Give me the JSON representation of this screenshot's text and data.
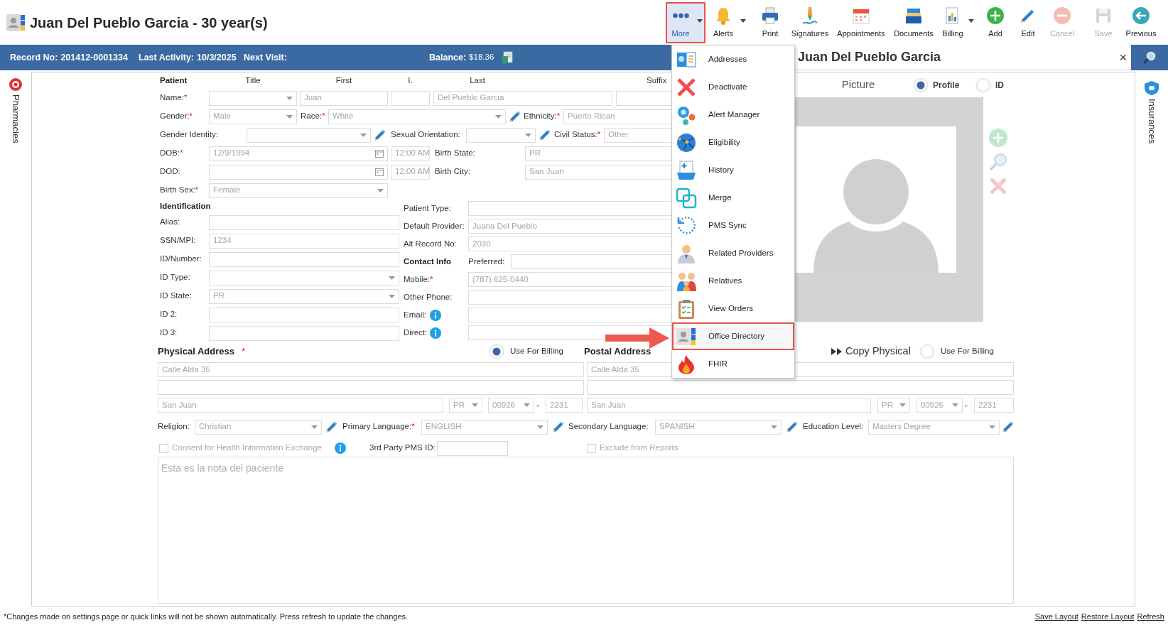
{
  "header": {
    "title": "Juan Del Pueblo Garcia - 30 year(s)",
    "toolbar": [
      {
        "label": "More",
        "highlighted": true,
        "dropdown": true,
        "disabled": false
      },
      {
        "label": "Alerts",
        "highlighted": false,
        "dropdown": true,
        "disabled": false
      },
      {
        "label": "Print",
        "highlighted": false,
        "dropdown": false,
        "disabled": false
      },
      {
        "label": "Signatures",
        "highlighted": false,
        "dropdown": false,
        "disabled": false
      },
      {
        "label": "Appointments",
        "highlighted": false,
        "dropdown": false,
        "disabled": false
      },
      {
        "label": "Documents",
        "highlighted": false,
        "dropdown": false,
        "disabled": false
      },
      {
        "label": "Billing",
        "highlighted": false,
        "dropdown": true,
        "disabled": false
      },
      {
        "label": "Add",
        "highlighted": false,
        "dropdown": false,
        "disabled": false
      },
      {
        "label": "Edit",
        "highlighted": false,
        "dropdown": false,
        "disabled": false
      },
      {
        "label": "Cancel",
        "highlighted": false,
        "dropdown": false,
        "disabled": true
      },
      {
        "label": "Save",
        "highlighted": false,
        "dropdown": false,
        "disabled": true
      },
      {
        "label": "Previous",
        "highlighted": false,
        "dropdown": false,
        "disabled": false
      }
    ]
  },
  "record_bar": {
    "items": [
      {
        "label": "Record No:",
        "value": "201412-0001334"
      },
      {
        "label": "Last Activity:",
        "value": "10/3/2025"
      },
      {
        "label": "Next Visit:"
      }
    ],
    "balance": {
      "label": "Balance:",
      "value": "$18.36"
    }
  },
  "more_menu": [
    {
      "label": "Addresses",
      "highlighted": false
    },
    {
      "label": "Deactivate",
      "highlighted": false
    },
    {
      "label": "Alert Manager",
      "highlighted": false
    },
    {
      "label": "Eligibility",
      "highlighted": false
    },
    {
      "label": "History",
      "highlighted": false
    },
    {
      "label": "Merge",
      "highlighted": false
    },
    {
      "label": "PMS Sync",
      "highlighted": false
    },
    {
      "label": "Related Providers",
      "highlighted": false
    },
    {
      "label": "Relatives",
      "highlighted": false
    },
    {
      "label": "View Orders",
      "highlighted": false
    },
    {
      "label": "Office Directory",
      "highlighted": true
    },
    {
      "label": "FHIR",
      "highlighted": false
    }
  ],
  "left_sidebar": {
    "label": "Pharmacies"
  },
  "right_sidebar": {
    "label": "Insurances"
  },
  "patient_panel": {
    "name": "Juan Del Pueblo Garcia",
    "close": "×",
    "picture_label": "Picture",
    "picture_options": [
      {
        "label": "Profile",
        "selected": true
      },
      {
        "label": "ID",
        "selected": false
      }
    ]
  },
  "form": {
    "patient_heading": "Patient",
    "name_columns": [
      "Title",
      "First",
      "I.",
      "Last",
      "Suffix"
    ],
    "fields": {
      "name": {
        "label": "Name:",
        "mark": "*",
        "first": "Juan",
        "last": "Del Pueblo Garcia"
      },
      "gender": {
        "label": "Gender:",
        "mark": "*",
        "value": "Male"
      },
      "race": {
        "label": "Race:",
        "mark": "*",
        "value": "White"
      },
      "ethnicity": {
        "label": "Ethnicity:",
        "mark": "*",
        "value": "Puerto Rican"
      },
      "gender_identity": {
        "label": "Gender Identity:"
      },
      "sexual_orientation": {
        "label": "Sexual Orientation:"
      },
      "civil_status": {
        "label": "Civil Status:",
        "mark": "*",
        "value": "Other"
      },
      "dob": {
        "label": "DOB:",
        "mark": "*",
        "value": "12/9/1994",
        "time": "12:00 AM"
      },
      "birth_state": {
        "label": "Birth State:",
        "value": "PR"
      },
      "dod": {
        "label": "DOD:",
        "time": "12:00 AM"
      },
      "birth_city": {
        "label": "Birth City:",
        "value": "San Juan"
      },
      "birth_sex": {
        "label": "Birth Sex:",
        "mark": "*",
        "value": "Female"
      },
      "alias": {
        "label": "Alias:"
      },
      "ssn": {
        "label": "SSN/MPI:",
        "value": "1234"
      },
      "id_number": {
        "label": "ID/Number:"
      },
      "id_type": {
        "label": "ID Type:"
      },
      "id_state": {
        "label": "ID State:",
        "value": "PR"
      },
      "id_2": {
        "label": "ID 2:"
      },
      "id_3": {
        "label": "ID 3:"
      },
      "patient_type": {
        "label": "Patient Type:"
      },
      "default_provider": {
        "label": "Default Provider:",
        "value": "Juana Del Pueblo"
      },
      "alt_record_no": {
        "label": "Alt Record No:",
        "value": "2030"
      },
      "preferred": {
        "label": "Preferred:"
      },
      "mobile": {
        "label": "Mobile:",
        "mark": "*",
        "value": "(787) 625-0440"
      },
      "other_phone": {
        "label": "Other Phone:"
      },
      "email": {
        "label": "Email:"
      },
      "direct": {
        "label": "Direct:"
      },
      "religion": {
        "label": "Religion:",
        "value": "Christian"
      },
      "primary_language": {
        "label": "Primary Language:",
        "mark": "*",
        "value": "ENGLISH"
      },
      "secondary_language": {
        "label": "Secondary Language:",
        "value": "SPANISH"
      },
      "education_level": {
        "label": "Education Level:",
        "value": "Masters Degree"
      },
      "third_party_pms_id": {
        "label": "3rd Party PMS ID:"
      }
    },
    "identification_heading": "Identification",
    "contact_heading": "Contact Info",
    "physical_address": {
      "heading": "Physical Address",
      "mark": "*",
      "use_for_billing": {
        "label": "Use For Billing",
        "selected": true
      },
      "line1": "Calle Alda 35",
      "city": "San Juan",
      "state": "PR",
      "zip": "00926",
      "separator": "-",
      "zip_ext": "2231"
    },
    "postal_address": {
      "heading": "Postal Address",
      "copy_label": "Copy Physical",
      "use_for_billing": {
        "label": "Use For Billing",
        "selected": false
      },
      "line1": "Calle Alda 35",
      "city": "San Juan",
      "state": "PR",
      "zip": "00926",
      "separator": "-",
      "zip_ext": "2231"
    },
    "consent": {
      "label": "Consent for Health Information Exchange",
      "checked": false
    },
    "exclude_from_reports": {
      "label": "Exclude from Reports",
      "checked": false
    },
    "notes": "Esta es la nota del paciente"
  },
  "footer": {
    "note": "*Changes made on settings page or quick links will not be shown automatically. Press refresh to update the changes.",
    "links": [
      "Save Layout",
      "Restore Layout",
      "Refresh"
    ]
  }
}
